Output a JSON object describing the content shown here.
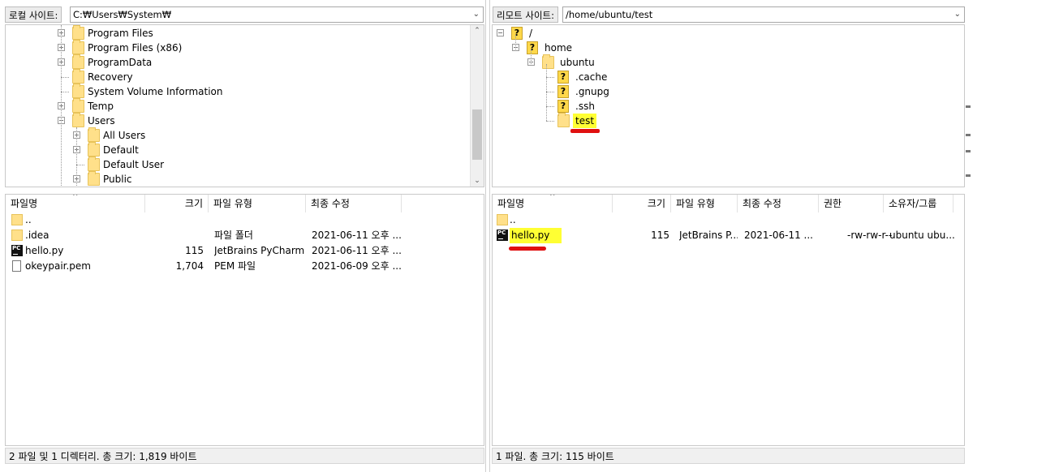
{
  "local": {
    "site_label": "로컬 사이트:",
    "path": "C:₩Users₩System₩",
    "tree": [
      {
        "label": "Program Files",
        "expander": "+"
      },
      {
        "label": "Program Files (x86)",
        "expander": "+"
      },
      {
        "label": "ProgramData",
        "expander": "+"
      },
      {
        "label": "Recovery",
        "expander": ""
      },
      {
        "label": "System Volume Information",
        "expander": ""
      },
      {
        "label": "Temp",
        "expander": "+"
      },
      {
        "label": "Users",
        "expander": "−"
      },
      {
        "label": "All Users",
        "expander": "+"
      },
      {
        "label": "Default",
        "expander": "+"
      },
      {
        "label": "Default User",
        "expander": ""
      },
      {
        "label": "Public",
        "expander": "+"
      }
    ],
    "columns": {
      "name": "파일명",
      "size": "크기",
      "type": "파일 유형",
      "modified": "최종 수정"
    },
    "files": [
      {
        "name": "..",
        "size": "",
        "type": "",
        "modified": ""
      },
      {
        "name": ".idea",
        "size": "",
        "type": "파일 폴더",
        "modified": "2021-06-11 오후 ..."
      },
      {
        "name": "hello.py",
        "size": "115",
        "type": "JetBrains PyCharm...",
        "modified": "2021-06-11 오후 ..."
      },
      {
        "name": "okeypair.pem",
        "size": "1,704",
        "type": "PEM 파일",
        "modified": "2021-06-09 오후 ..."
      }
    ],
    "status": "2 파일 및 1 디렉터리. 총 크기: 1,819 바이트"
  },
  "remote": {
    "site_label": "리모트 사이트:",
    "path": "/home/ubuntu/test",
    "tree": [
      {
        "label": "/"
      },
      {
        "label": "home"
      },
      {
        "label": "ubuntu"
      },
      {
        "label": ".cache"
      },
      {
        "label": ".gnupg"
      },
      {
        "label": ".ssh"
      },
      {
        "label": "test"
      }
    ],
    "columns": {
      "name": "파일명",
      "size": "크기",
      "type": "파일 유형",
      "modified": "최종 수정",
      "perm": "권한",
      "owner": "소유자/그룹"
    },
    "files": [
      {
        "name": "..",
        "size": "",
        "type": "",
        "modified": "",
        "perm": "",
        "owner": ""
      },
      {
        "name": "hello.py",
        "size": "115",
        "type": "JetBrains P...",
        "modified": "2021-06-11 ...",
        "perm": "-rw-rw-r--",
        "owner": "ubuntu ubu..."
      }
    ],
    "status": "1 파일. 총 크기: 115 바이트"
  },
  "colors": {
    "highlight": "#ffff33",
    "annotation": "#e01010",
    "folder": "#ffe08a"
  }
}
